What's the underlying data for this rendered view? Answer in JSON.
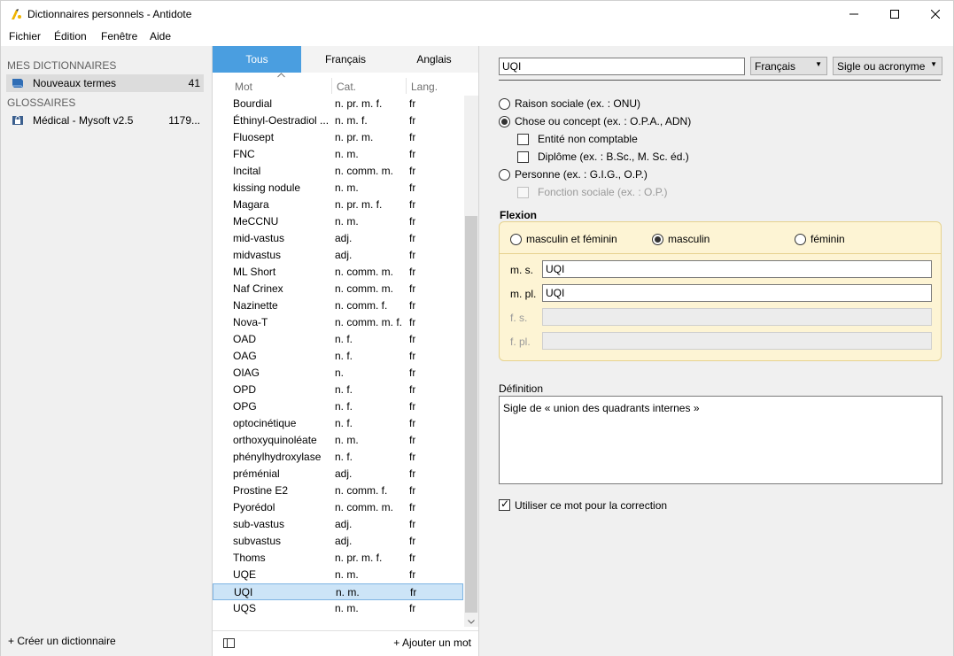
{
  "window": {
    "title": "Dictionnaires personnels - Antidote",
    "controls": {
      "minimize": "—",
      "maximize": "☐",
      "close": "✕"
    }
  },
  "menu": [
    "Fichier",
    "Édition",
    "Fenêtre",
    "Aide"
  ],
  "sidebar": {
    "mine_header": "MES DICTIONNAIRES",
    "mine": [
      {
        "label": "Nouveaux termes",
        "count": "41",
        "icon": "book-icon"
      }
    ],
    "glossaries_header": "GLOSSAIRES",
    "glossaries": [
      {
        "label": "Médical - Mysoft v2.5",
        "count": "1179...",
        "icon": "lock-book-icon"
      }
    ],
    "create_label": "+ Créer un dictionnaire"
  },
  "wordlist": {
    "tabs": [
      "Tous",
      "Français",
      "Anglais"
    ],
    "active_tab": 0,
    "columns": {
      "mot": "Mot",
      "cat": "Cat.",
      "lang": "Lang."
    },
    "rows": [
      [
        "Bourdial",
        "n. pr. m. f.",
        "fr"
      ],
      [
        "Éthinyl-Oestradiol ...",
        "n. m. f.",
        "fr"
      ],
      [
        "Fluosept",
        "n. pr. m.",
        "fr"
      ],
      [
        "FNC",
        "n. m.",
        "fr"
      ],
      [
        "Incital",
        "n. comm. m.",
        "fr"
      ],
      [
        "kissing nodule",
        "n. m.",
        "fr"
      ],
      [
        "Magara",
        "n. pr. m. f.",
        "fr"
      ],
      [
        "MeCCNU",
        "n. m.",
        "fr"
      ],
      [
        "mid-vastus",
        "adj.",
        "fr"
      ],
      [
        "midvastus",
        "adj.",
        "fr"
      ],
      [
        "ML Short",
        "n. comm. m.",
        "fr"
      ],
      [
        "Naf Crinex",
        "n. comm. m.",
        "fr"
      ],
      [
        "Nazinette",
        "n. comm. f.",
        "fr"
      ],
      [
        "Nova-T",
        "n. comm. m. f.",
        "fr"
      ],
      [
        "OAD",
        "n. f.",
        "fr"
      ],
      [
        "OAG",
        "n. f.",
        "fr"
      ],
      [
        "OIAG",
        "n.",
        "fr"
      ],
      [
        "OPD",
        "n. f.",
        "fr"
      ],
      [
        "OPG",
        "n. f.",
        "fr"
      ],
      [
        "optocinétique",
        "n. f.",
        "fr"
      ],
      [
        "orthoxyquinoléate",
        "n. m.",
        "fr"
      ],
      [
        "phénylhydroxylase",
        "n. f.",
        "fr"
      ],
      [
        "préménial",
        "adj.",
        "fr"
      ],
      [
        "Prostine E2",
        "n. comm. f.",
        "fr"
      ],
      [
        "Pyorédol",
        "n. comm. m.",
        "fr"
      ],
      [
        "sub-vastus",
        "adj.",
        "fr"
      ],
      [
        "subvastus",
        "adj.",
        "fr"
      ],
      [
        "Thoms",
        "n. pr. m. f.",
        "fr"
      ],
      [
        "UQE",
        "n. m.",
        "fr"
      ],
      [
        "UQI",
        "n. m.",
        "fr"
      ],
      [
        "UQS",
        "n. m.",
        "fr"
      ]
    ],
    "selected_index": 29,
    "add_label": "+ Ajouter un mot"
  },
  "editor": {
    "word": "UQI",
    "language": "Français",
    "type": "Sigle ou acronyme",
    "options": {
      "raison_sociale": "Raison sociale (ex. : ONU)",
      "chose": "Chose ou concept (ex. : O.P.A., ADN)",
      "entite": "Entité non comptable",
      "diplome": "Diplôme (ex. : B.Sc., M. Sc. éd.)",
      "personne": "Personne (ex. : G.I.G., O.P.)",
      "fonction": "Fonction sociale (ex. : O.P.)"
    },
    "flexion": {
      "title": "Flexion",
      "genres": [
        "masculin et féminin",
        "masculin",
        "féminin"
      ],
      "selected_genre": 1,
      "ms_label": "m. s.",
      "ms_value": "UQI",
      "mpl_label": "m. pl.",
      "mpl_value": "UQI",
      "fs_label": "f. s.",
      "fs_value": "",
      "fpl_label": "f. pl.",
      "fpl_value": ""
    },
    "definition_label": "Définition",
    "definition": "Sigle de « union des quadrants internes »",
    "use_for_correction": "Utiliser ce mot pour la correction",
    "colors": {
      "tab_active": "#4a9ee0",
      "flexion_bg": "#fdf4d4",
      "row_selected": "#cce4f7"
    }
  }
}
